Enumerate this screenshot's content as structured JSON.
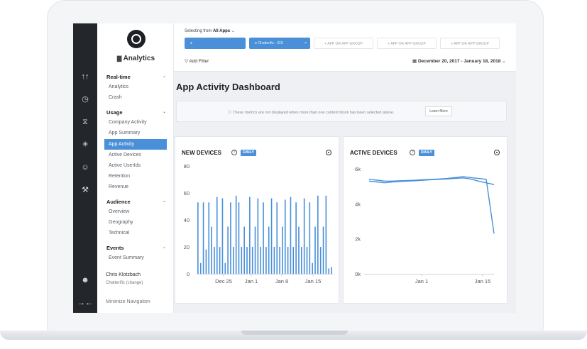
{
  "rail": {
    "icons": [
      "bar-chart-icon",
      "clock-icon",
      "award-icon",
      "bug-icon",
      "users-icon",
      "wrench-icon",
      "user-circle-icon",
      "expand-icon"
    ],
    "glyphs": [
      "↑↑",
      "◷",
      "⧖",
      "☀",
      "☺",
      "⚒",
      "☻",
      "→←"
    ]
  },
  "nav": {
    "brand": "Analytics",
    "sections": [
      {
        "label": "Real-time",
        "items": [
          "Analytics",
          "Crash"
        ]
      },
      {
        "label": "Usage",
        "items": [
          "Company Activity",
          "App Summary",
          "App Activity",
          "Active Devices",
          "Active UserIds",
          "Retention",
          "Revenue"
        ]
      },
      {
        "label": "Audience",
        "items": [
          "Overview",
          "Geography",
          "Technical"
        ]
      },
      {
        "label": "Events",
        "items": [
          "Event Summary"
        ]
      }
    ],
    "active_item": "App Activity",
    "user_name": "Chris Klotzbach",
    "user_org": "Chatterific (change)",
    "minimize": "Minimize Navigation"
  },
  "topbar": {
    "selecting_prefix": "Selecting from",
    "selecting_value": "All Apps",
    "app_tabs": [
      {
        "label": "",
        "selected": true
      },
      {
        "label": "Chatterific - iOS",
        "selected": true
      },
      {
        "label": "+ APP OR APP GROUP",
        "selected": false
      },
      {
        "label": "+ APP OR APP GROUP",
        "selected": false
      },
      {
        "label": "+ APP OR APP GROUP",
        "selected": false
      }
    ],
    "add_filter": "Add Filter",
    "date_range": "December 20, 2017 - January 18, 2018"
  },
  "page": {
    "title": "App Activity Dashboard",
    "notice": "These metrics are not displayed when more than one context block has been selected above.",
    "learn_more": "Learn More"
  },
  "colors": {
    "accent": "#4a90d9",
    "rail": "#23262b"
  },
  "chart_data": [
    {
      "type": "bar",
      "title": "NEW DEVICES",
      "badge": "DAILY",
      "ylim": [
        0,
        80
      ],
      "yticks": [
        0,
        20,
        40,
        60,
        80
      ],
      "xticks": [
        "Dec 25",
        "Jan 1",
        "Jan 8",
        "Jan 15"
      ],
      "values": [
        53,
        8,
        53,
        18,
        53,
        35,
        20,
        57,
        20,
        56,
        8,
        35,
        53,
        20,
        58,
        53,
        20,
        35,
        20,
        57,
        20,
        35,
        56,
        20,
        53,
        20,
        35,
        56,
        20,
        53,
        20,
        35,
        55,
        20,
        57,
        20,
        53,
        35,
        20,
        56,
        20,
        53,
        8,
        35,
        58,
        20,
        35,
        58,
        4,
        5
      ]
    },
    {
      "type": "line",
      "title": "ACTIVE DEVICES",
      "badge": "DAILY",
      "ylim": [
        0,
        6000
      ],
      "yticks": [
        "0k",
        "2k",
        "4k",
        "6k"
      ],
      "xticks": [
        "Jan 1",
        "Jan 15"
      ],
      "series": [
        {
          "values": [
            5400,
            5350,
            5300,
            5300,
            5320,
            5330,
            5350,
            5380,
            5400,
            5420,
            5450,
            5500,
            5550,
            5500,
            5450,
            5400,
            2300
          ]
        },
        {
          "values": [
            5300,
            5250,
            5200,
            5250,
            5280,
            5300,
            5320,
            5350,
            5380,
            5400,
            5420,
            5450,
            5480,
            5420,
            5300,
            5200,
            5100
          ]
        }
      ]
    }
  ]
}
